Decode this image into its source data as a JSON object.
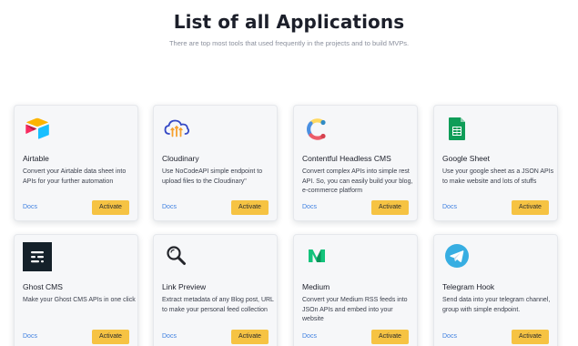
{
  "header": {
    "title": "List of all Applications",
    "subtitle": "There are top most tools that used frequently in the projects and to build MVPs."
  },
  "common": {
    "docs_label": "Docs",
    "activate_label": "Activate"
  },
  "colors": {
    "button": "#f6c343",
    "link": "#3d7fe0",
    "card_bg": "#f6f7f9"
  },
  "apps": [
    {
      "name": "Airtable",
      "icon": "airtable-icon",
      "description": "Convert your Airtable data sheet into APIs for your further automation"
    },
    {
      "name": "Cloudinary",
      "icon": "cloudinary-icon",
      "description": "Use NoCodeAPI simple endpoint to upload files to the Cloudinary\""
    },
    {
      "name": "Contentful Headless CMS",
      "icon": "contentful-icon",
      "description": "Convert complex APIs into simple rest API. So, you can easily build your blog, e-commerce platform"
    },
    {
      "name": "Google Sheet",
      "icon": "google-sheets-icon",
      "description": "Use your google sheet as a JSON APIs to make website and lots of stuffs"
    },
    {
      "name": "Ghost CMS",
      "icon": "ghost-icon",
      "description": "Make your Ghost CMS APIs in one click"
    },
    {
      "name": "Link Preview",
      "icon": "magnifier-icon",
      "description": "Extract metadata of any Blog post, URL to make your personal feed collection"
    },
    {
      "name": "Medium",
      "icon": "medium-icon",
      "description": "Convert your Medium RSS feeds into JSOn APIs and embed into your website"
    },
    {
      "name": "Telegram Hook",
      "icon": "telegram-icon",
      "description": "Send data into your telegram channel, group with simple endpoint."
    }
  ]
}
